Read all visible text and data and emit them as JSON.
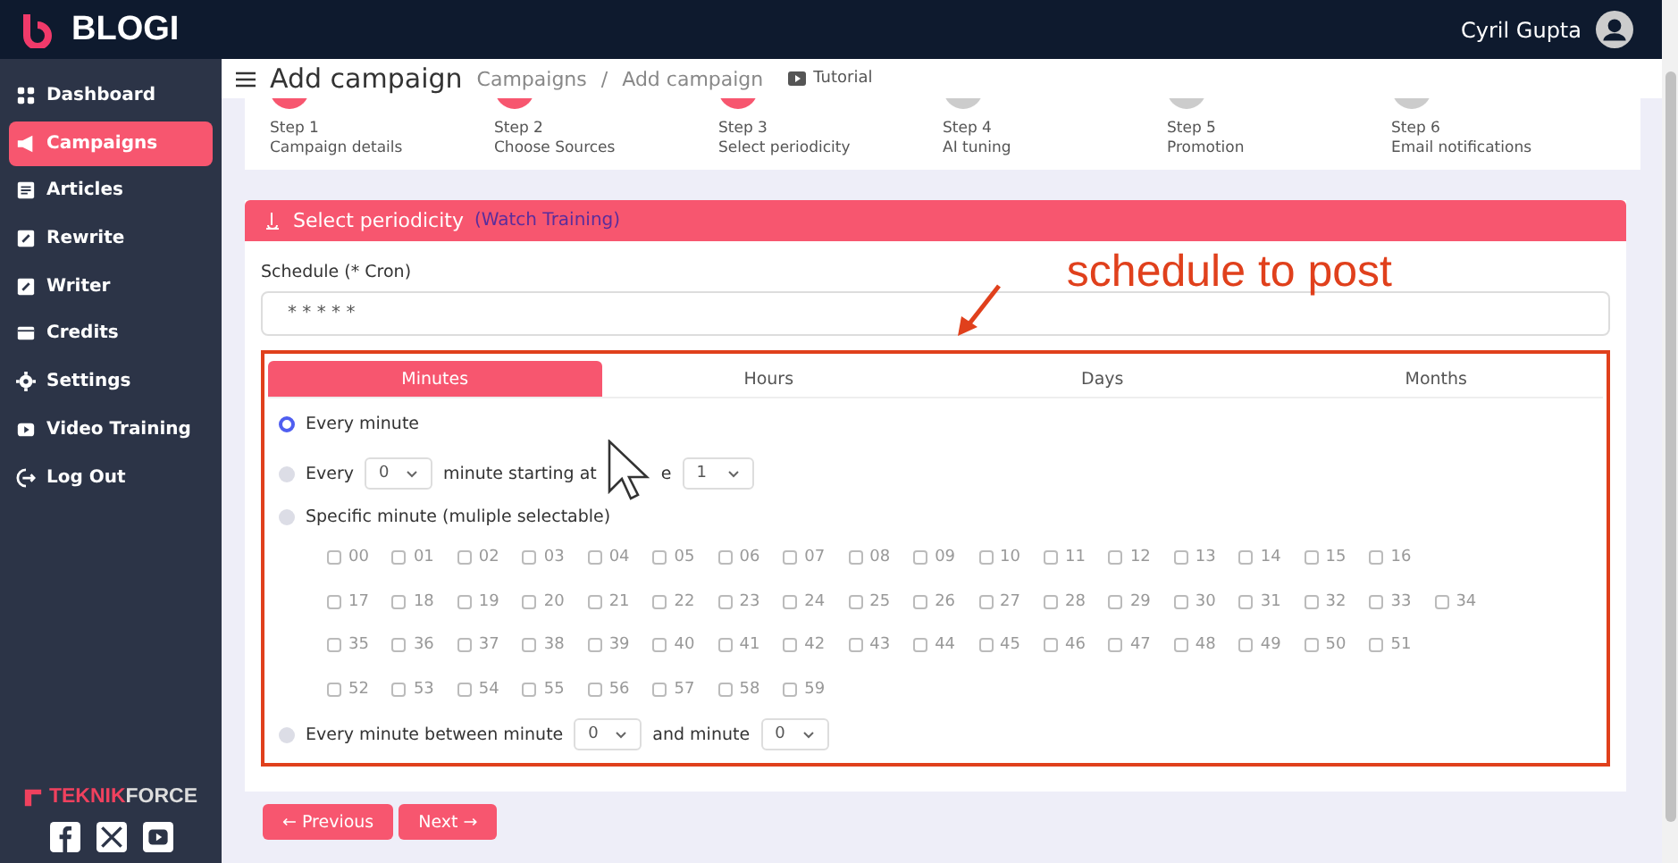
{
  "brand": {
    "name": "BLOGI"
  },
  "user": {
    "name": "Cyril Gupta"
  },
  "sidebar": {
    "items": [
      {
        "label": "Dashboard",
        "selected": false
      },
      {
        "label": "Campaigns",
        "selected": true
      },
      {
        "label": "Articles",
        "selected": false
      },
      {
        "label": "Rewrite",
        "selected": false
      },
      {
        "label": "Writer",
        "selected": false
      },
      {
        "label": "Credits",
        "selected": false
      },
      {
        "label": "Settings",
        "selected": false
      },
      {
        "label": "Video Training",
        "selected": false
      },
      {
        "label": "Log Out",
        "selected": false
      }
    ],
    "footer": {
      "brand_a": "TEKNIK",
      "brand_b": "FORCE"
    }
  },
  "page": {
    "title": "Add campaign",
    "breadcrumb": [
      "Campaigns",
      "/",
      "Add campaign"
    ],
    "tutorial": "Tutorial"
  },
  "steps": [
    {
      "step": "Step 1",
      "label": "Campaign details",
      "active": true
    },
    {
      "step": "Step 2",
      "label": "Choose Sources",
      "active": true
    },
    {
      "step": "Step 3",
      "label": "Select periodicity",
      "active": true
    },
    {
      "step": "Step 4",
      "label": "AI tuning",
      "active": false
    },
    {
      "step": "Step 5",
      "label": "Promotion",
      "active": false
    },
    {
      "step": "Step 6",
      "label": "Email notifications",
      "active": false
    }
  ],
  "panel": {
    "title": "Select periodicity",
    "link": "(Watch Training)",
    "schedule_label": "Schedule (* Cron)",
    "schedule_value": "* * * * *"
  },
  "annotation": {
    "text": "schedule to post"
  },
  "tabs": [
    {
      "label": "Minutes",
      "selected": true
    },
    {
      "label": "Hours",
      "selected": false
    },
    {
      "label": "Days",
      "selected": false
    },
    {
      "label": "Months",
      "selected": false
    }
  ],
  "options": {
    "every_minute": {
      "label": "Every minute",
      "selected": true
    },
    "every_n": {
      "selected": false,
      "label_a": "Every",
      "value_a": "0",
      "label_b": "minute starting at",
      "label_c": "e",
      "value_b": "1"
    },
    "specific": {
      "selected": false,
      "label": "Specific minute (muliple selectable)"
    },
    "between": {
      "selected": false,
      "label_a": "Every minute between minute",
      "value_a": "0",
      "label_b": "and minute",
      "value_b": "0"
    }
  },
  "minute_rows": [
    [
      {
        "label": "00",
        "checked": false
      },
      {
        "label": "01",
        "checked": false
      },
      {
        "label": "02",
        "checked": false
      },
      {
        "label": "03",
        "checked": false
      },
      {
        "label": "04",
        "checked": false
      },
      {
        "label": "05",
        "checked": false
      },
      {
        "label": "06",
        "checked": false
      },
      {
        "label": "07",
        "checked": false
      },
      {
        "label": "08",
        "checked": false
      },
      {
        "label": "09",
        "checked": false
      },
      {
        "label": "10",
        "checked": false
      },
      {
        "label": "11",
        "checked": false
      },
      {
        "label": "12",
        "checked": false
      },
      {
        "label": "13",
        "checked": false
      },
      {
        "label": "14",
        "checked": false
      },
      {
        "label": "15",
        "checked": false
      },
      {
        "label": "16",
        "checked": false
      }
    ],
    [
      {
        "label": "17",
        "checked": false
      },
      {
        "label": "18",
        "checked": false
      },
      {
        "label": "19",
        "checked": false
      },
      {
        "label": "20",
        "checked": false
      },
      {
        "label": "21",
        "checked": false
      },
      {
        "label": "22",
        "checked": false
      },
      {
        "label": "23",
        "checked": false
      },
      {
        "label": "24",
        "checked": false
      },
      {
        "label": "25",
        "checked": false
      },
      {
        "label": "26",
        "checked": false
      },
      {
        "label": "27",
        "checked": false
      },
      {
        "label": "28",
        "checked": false
      },
      {
        "label": "29",
        "checked": false
      },
      {
        "label": "30",
        "checked": false
      },
      {
        "label": "31",
        "checked": false
      },
      {
        "label": "32",
        "checked": false
      },
      {
        "label": "33",
        "checked": false
      },
      {
        "label": "34",
        "checked": false
      }
    ],
    [
      {
        "label": "35",
        "checked": false
      },
      {
        "label": "36",
        "checked": false
      },
      {
        "label": "37",
        "checked": false
      },
      {
        "label": "38",
        "checked": false
      },
      {
        "label": "39",
        "checked": false
      },
      {
        "label": "40",
        "checked": false
      },
      {
        "label": "41",
        "checked": false
      },
      {
        "label": "42",
        "checked": false
      },
      {
        "label": "43",
        "checked": false
      },
      {
        "label": "44",
        "checked": false
      },
      {
        "label": "45",
        "checked": false
      },
      {
        "label": "46",
        "checked": false
      },
      {
        "label": "47",
        "checked": false
      },
      {
        "label": "48",
        "checked": false
      },
      {
        "label": "49",
        "checked": false
      },
      {
        "label": "50",
        "checked": false
      },
      {
        "label": "51",
        "checked": false
      }
    ],
    [
      {
        "label": "52",
        "checked": false
      },
      {
        "label": "53",
        "checked": false
      },
      {
        "label": "54",
        "checked": false
      },
      {
        "label": "55",
        "checked": false
      },
      {
        "label": "56",
        "checked": false
      },
      {
        "label": "57",
        "checked": false
      },
      {
        "label": "58",
        "checked": false
      },
      {
        "label": "59",
        "checked": false
      }
    ]
  ],
  "buttons": {
    "previous": "← Previous",
    "next": "Next →"
  }
}
